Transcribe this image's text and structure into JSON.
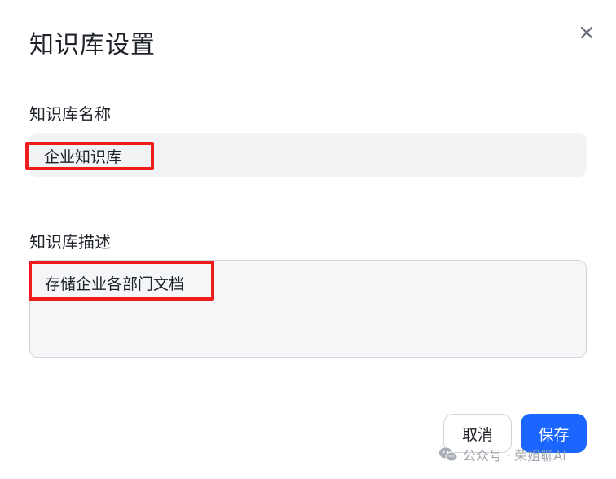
{
  "dialog": {
    "title": "知识库设置",
    "close_icon": "close-icon"
  },
  "form": {
    "name_label": "知识库名称",
    "name_value": "企业知识库",
    "desc_label": "知识库描述",
    "desc_value": "存储企业各部门文档"
  },
  "actions": {
    "cancel_label": "取消",
    "save_label": "保存"
  },
  "watermark": {
    "text": "公众号 · 荣姐聊AI",
    "icon": "wechat-icon"
  },
  "colors": {
    "primary": "#1a66ff",
    "highlight": "#ee1c1c",
    "input_bg": "#f2f3f5"
  }
}
